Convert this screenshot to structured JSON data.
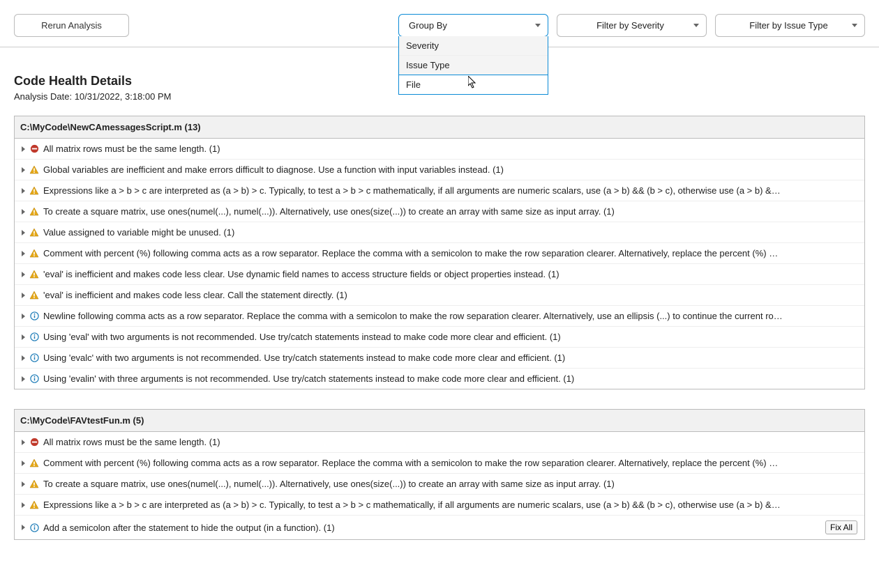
{
  "toolbar": {
    "rerun_label": "Rerun Analysis",
    "groupby_label": "Group By",
    "filter_severity_label": "Filter by Severity",
    "filter_issuetype_label": "Filter by Issue Type",
    "dropdown": {
      "items": [
        "Severity",
        "Issue Type",
        "File"
      ],
      "selected": "File"
    }
  },
  "header": {
    "title": "Code Health Details",
    "date_label": "Analysis Date: 10/31/2022, 3:18:00 PM"
  },
  "groups": [
    {
      "file": "C:\\MyCode\\NewCAmessagesScript.m (13)",
      "issues": [
        {
          "sev": "error",
          "text": "All matrix rows must be the same length. (1)"
        },
        {
          "sev": "warn",
          "text": "Global variables are inefficient and make errors difficult to diagnose. Use a function with input variables instead. (1)"
        },
        {
          "sev": "warn",
          "text": "Expressions like a > b > c are interpreted as (a > b) > c. Typically, to test a > b > c mathematically, if all arguments are numeric scalars, use (a > b) && (b > c), otherwise use (a > b) &…"
        },
        {
          "sev": "warn",
          "text": "To create a square matrix, use ones(numel(...), numel(...)). Alternatively, use ones(size(...)) to create an array with same size as input array. (1)"
        },
        {
          "sev": "warn",
          "text": "Value assigned to variable might be unused. (1)"
        },
        {
          "sev": "warn",
          "text": "Comment with percent (%) following comma acts as a row separator. Replace the comma with a semicolon to make the row separation clearer. Alternatively, replace the percent (%) …"
        },
        {
          "sev": "warn",
          "text": "'eval' is inefficient and makes code less clear. Use dynamic field names to access structure fields or object properties instead. (1)"
        },
        {
          "sev": "warn",
          "text": "'eval' is inefficient and makes code less clear. Call the statement directly. (1)"
        },
        {
          "sev": "info",
          "text": "Newline following comma acts as a row separator. Replace the comma with a semicolon to make the row separation clearer. Alternatively, use an ellipsis (...) to continue the current ro…"
        },
        {
          "sev": "info",
          "text": "Using 'eval' with two arguments is not recommended. Use try/catch statements instead to make code more clear and efficient. (1)"
        },
        {
          "sev": "info",
          "text": "Using 'evalc' with two arguments is not recommended. Use try/catch statements instead to make code more clear and efficient. (1)"
        },
        {
          "sev": "info",
          "text": "Using 'evalin' with three arguments is not recommended. Use try/catch statements instead to make code more clear and efficient. (1)"
        }
      ]
    },
    {
      "file": "C:\\MyCode\\FAVtestFun.m (5)",
      "issues": [
        {
          "sev": "error",
          "text": "All matrix rows must be the same length. (1)"
        },
        {
          "sev": "warn",
          "text": "Comment with percent (%) following comma acts as a row separator. Replace the comma with a semicolon to make the row separation clearer. Alternatively, replace the percent (%) …"
        },
        {
          "sev": "warn",
          "text": "To create a square matrix, use ones(numel(...), numel(...)). Alternatively, use ones(size(...)) to create an array with same size as input array. (1)"
        },
        {
          "sev": "warn",
          "text": "Expressions like a > b > c are interpreted as (a > b) > c. Typically, to test a > b > c mathematically, if all arguments are numeric scalars, use (a > b) && (b > c), otherwise use (a > b) &…"
        },
        {
          "sev": "info",
          "text": "Add a semicolon after the statement to hide the output (in a function). (1)",
          "fixall": "Fix All"
        }
      ]
    }
  ]
}
